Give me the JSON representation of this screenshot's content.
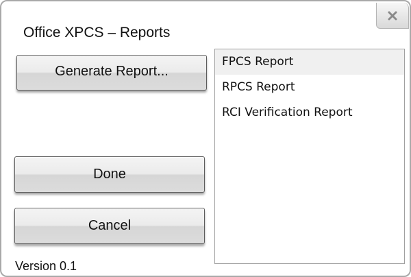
{
  "dialog": {
    "title": "Office XPCS – Reports",
    "close_icon": "close-icon"
  },
  "buttons": {
    "generate_label": "Generate Report...",
    "done_label": "Done",
    "cancel_label": "Cancel"
  },
  "footer": {
    "version": "Version 0.1"
  },
  "reports": {
    "items": [
      {
        "label": "FPCS Report",
        "selected": true
      },
      {
        "label": "RPCS Report",
        "selected": false
      },
      {
        "label": "RCI Verification Report",
        "selected": false
      }
    ]
  },
  "colors": {
    "border": "#a9a9a9",
    "selected_row": "#f0f0f0",
    "button_border": "#5c5c5c"
  }
}
